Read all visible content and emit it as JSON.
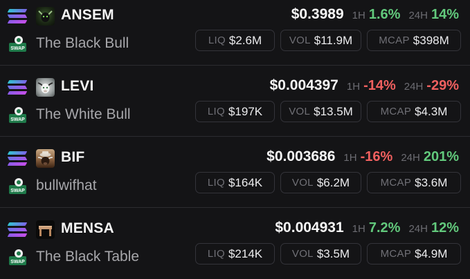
{
  "labels": {
    "h1": "1H",
    "h24": "24H",
    "liq": "LIQ",
    "vol": "VOL",
    "mcap": "MCAP",
    "swap": "SWAP"
  },
  "colors": {
    "positive": "#62c97c",
    "negative": "#f0605f",
    "background": "#141416"
  },
  "tokens": [
    {
      "symbol": "ANSEM",
      "name": "The Black Bull",
      "avatar_icon": "black-bull-avatar",
      "price": "$0.3989",
      "change_1h": "1.6%",
      "change_1h_sign": "pos",
      "change_24h": "14%",
      "change_24h_sign": "pos",
      "liq": "$2.6M",
      "vol": "$11.9M",
      "mcap": "$398M"
    },
    {
      "symbol": "LEVI",
      "name": "The White Bull",
      "avatar_icon": "white-bull-avatar",
      "price": "$0.004397",
      "change_1h": "-14%",
      "change_1h_sign": "neg",
      "change_24h": "-29%",
      "change_24h_sign": "neg",
      "liq": "$197K",
      "vol": "$13.5M",
      "mcap": "$4.3M"
    },
    {
      "symbol": "BIF",
      "name": "bullwifhat",
      "avatar_icon": "bull-with-hat-avatar",
      "price": "$0.003686",
      "change_1h": "-16%",
      "change_1h_sign": "neg",
      "change_24h": "201%",
      "change_24h_sign": "pos",
      "liq": "$164K",
      "vol": "$6.2M",
      "mcap": "$3.6M"
    },
    {
      "symbol": "MENSA",
      "name": "The Black Table",
      "avatar_icon": "black-table-avatar",
      "price": "$0.004931",
      "change_1h": "7.2%",
      "change_1h_sign": "pos",
      "change_24h": "12%",
      "change_24h_sign": "pos",
      "liq": "$214K",
      "vol": "$3.5M",
      "mcap": "$4.9M"
    }
  ]
}
